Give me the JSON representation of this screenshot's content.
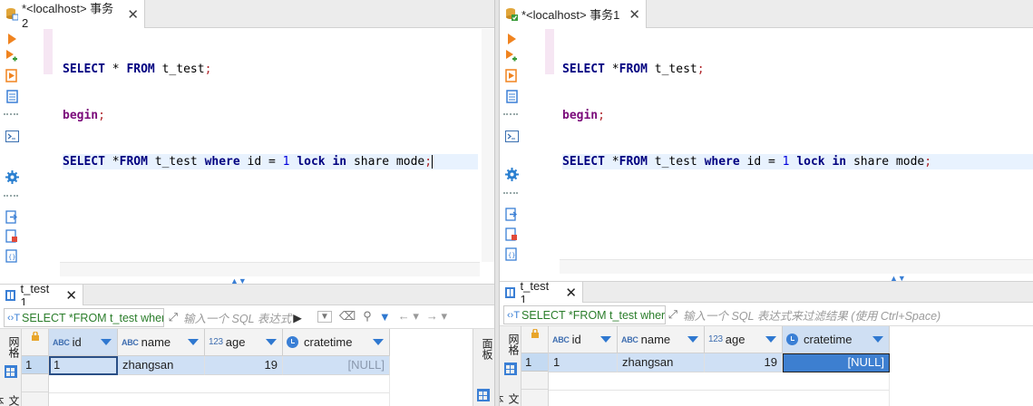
{
  "left_pane": {
    "tab": {
      "title": "*<localhost> 事务2",
      "close": "✕"
    },
    "code": [
      [
        "SELECT * FROM t_test;"
      ],
      [
        "begin;"
      ],
      [
        "SELECT *FROM t_test where id = 1 lock in share mode;"
      ]
    ],
    "results_tab": {
      "label": "t_test 1",
      "close": "✕"
    },
    "sql_box": "SELECT *FROM t_test wher",
    "filter_placeholder": "输入一个 SQL 表达式",
    "vtab_label": "网格",
    "vtab_label2": "文本",
    "right_vtab_label": "面板",
    "columns": [
      {
        "type": "ABC",
        "name": "id"
      },
      {
        "type": "ABC",
        "name": "name"
      },
      {
        "type": "123",
        "name": "age"
      },
      {
        "type": "clock",
        "name": "cratetime"
      }
    ],
    "rows": [
      {
        "num": "1",
        "id": "1",
        "name": "zhangsan",
        "age": "19",
        "cratetime": "[NULL]"
      }
    ]
  },
  "right_pane": {
    "tab": {
      "title": "*<localhost> 事务1",
      "close": "✕"
    },
    "results_tab": {
      "label": "t_test 1",
      "close": "✕"
    },
    "sql_box": "SELECT *FROM t_test wher",
    "filter_placeholder": "输入一个 SQL 表达式来过滤结果 (使用 Ctrl+Space)",
    "vtab_label": "网格",
    "vtab_label2": "文本",
    "columns": [
      {
        "type": "ABC",
        "name": "id"
      },
      {
        "type": "ABC",
        "name": "name"
      },
      {
        "type": "123",
        "name": "age"
      },
      {
        "type": "clock",
        "name": "cratetime"
      }
    ],
    "rows": [
      {
        "num": "1",
        "id": "1",
        "name": "zhangsan",
        "age": "19",
        "cratetime": "[NULL]"
      }
    ]
  },
  "colors": {
    "accent": "#3a7fd5",
    "keyword": "#7a0a7a",
    "number": "#0000dd",
    "selection": "#cfe0f5"
  }
}
